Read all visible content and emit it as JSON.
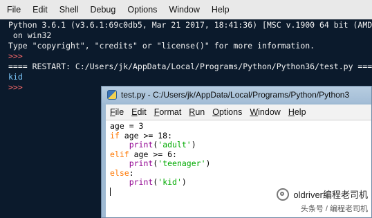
{
  "shell": {
    "menu": [
      "File",
      "Edit",
      "Shell",
      "Debug",
      "Options",
      "Window",
      "Help"
    ],
    "lines": [
      {
        "text": "Python 3.6.1 (v3.6.1:69c0db5, Mar 21 2017, 18:41:36) [MSC v.1900 64 bit (AMD",
        "style": "normal"
      },
      {
        "text": " on win32",
        "style": "normal"
      },
      {
        "text": "Type \"copyright\", \"credits\" or \"license()\" for more information.",
        "style": "normal"
      },
      {
        "text": ">>>",
        "style": "prompt"
      },
      {
        "text": "==== RESTART: C:/Users/jk/AppData/Local/Programs/Python/Python36/test.py ===",
        "style": "normal"
      },
      {
        "text": "kid",
        "style": "out-blue"
      },
      {
        "text": ">>>",
        "style": "prompt"
      }
    ]
  },
  "editor": {
    "title": "test.py - C:/Users/jk/AppData/Local/Programs/Python/Python3",
    "menu": [
      {
        "u": "F",
        "rest": "ile"
      },
      {
        "u": "E",
        "rest": "dit"
      },
      {
        "u": "F",
        "rest": "ormat"
      },
      {
        "u": "R",
        "rest": "un"
      },
      {
        "u": "O",
        "rest": "ptions"
      },
      {
        "u": "W",
        "rest": "indow"
      },
      {
        "u": "H",
        "rest": "elp"
      }
    ],
    "code": [
      {
        "parts": [
          {
            "t": "age = 3",
            "c": "plain"
          }
        ]
      },
      {
        "parts": [
          {
            "t": "if",
            "c": "kw"
          },
          {
            "t": " age >= 18:",
            "c": "plain"
          }
        ]
      },
      {
        "parts": [
          {
            "t": "    ",
            "c": "plain"
          },
          {
            "t": "print",
            "c": "bi"
          },
          {
            "t": "(",
            "c": "plain"
          },
          {
            "t": "'adult'",
            "c": "str"
          },
          {
            "t": ")",
            "c": "plain"
          }
        ]
      },
      {
        "parts": [
          {
            "t": "elif",
            "c": "kw"
          },
          {
            "t": " age >= 6:",
            "c": "plain"
          }
        ]
      },
      {
        "parts": [
          {
            "t": "    ",
            "c": "plain"
          },
          {
            "t": "print",
            "c": "bi"
          },
          {
            "t": "(",
            "c": "plain"
          },
          {
            "t": "'teenager'",
            "c": "str"
          },
          {
            "t": ")",
            "c": "plain"
          }
        ]
      },
      {
        "parts": [
          {
            "t": "else",
            "c": "kw"
          },
          {
            "t": ":",
            "c": "plain"
          }
        ]
      },
      {
        "parts": [
          {
            "t": "    ",
            "c": "plain"
          },
          {
            "t": "print",
            "c": "bi"
          },
          {
            "t": "(",
            "c": "plain"
          },
          {
            "t": "'kid'",
            "c": "str"
          },
          {
            "t": ")",
            "c": "plain"
          }
        ]
      }
    ]
  },
  "watermark": {
    "main": "oldriver编程老司机",
    "sub": "头条号 / 编程老司机"
  }
}
